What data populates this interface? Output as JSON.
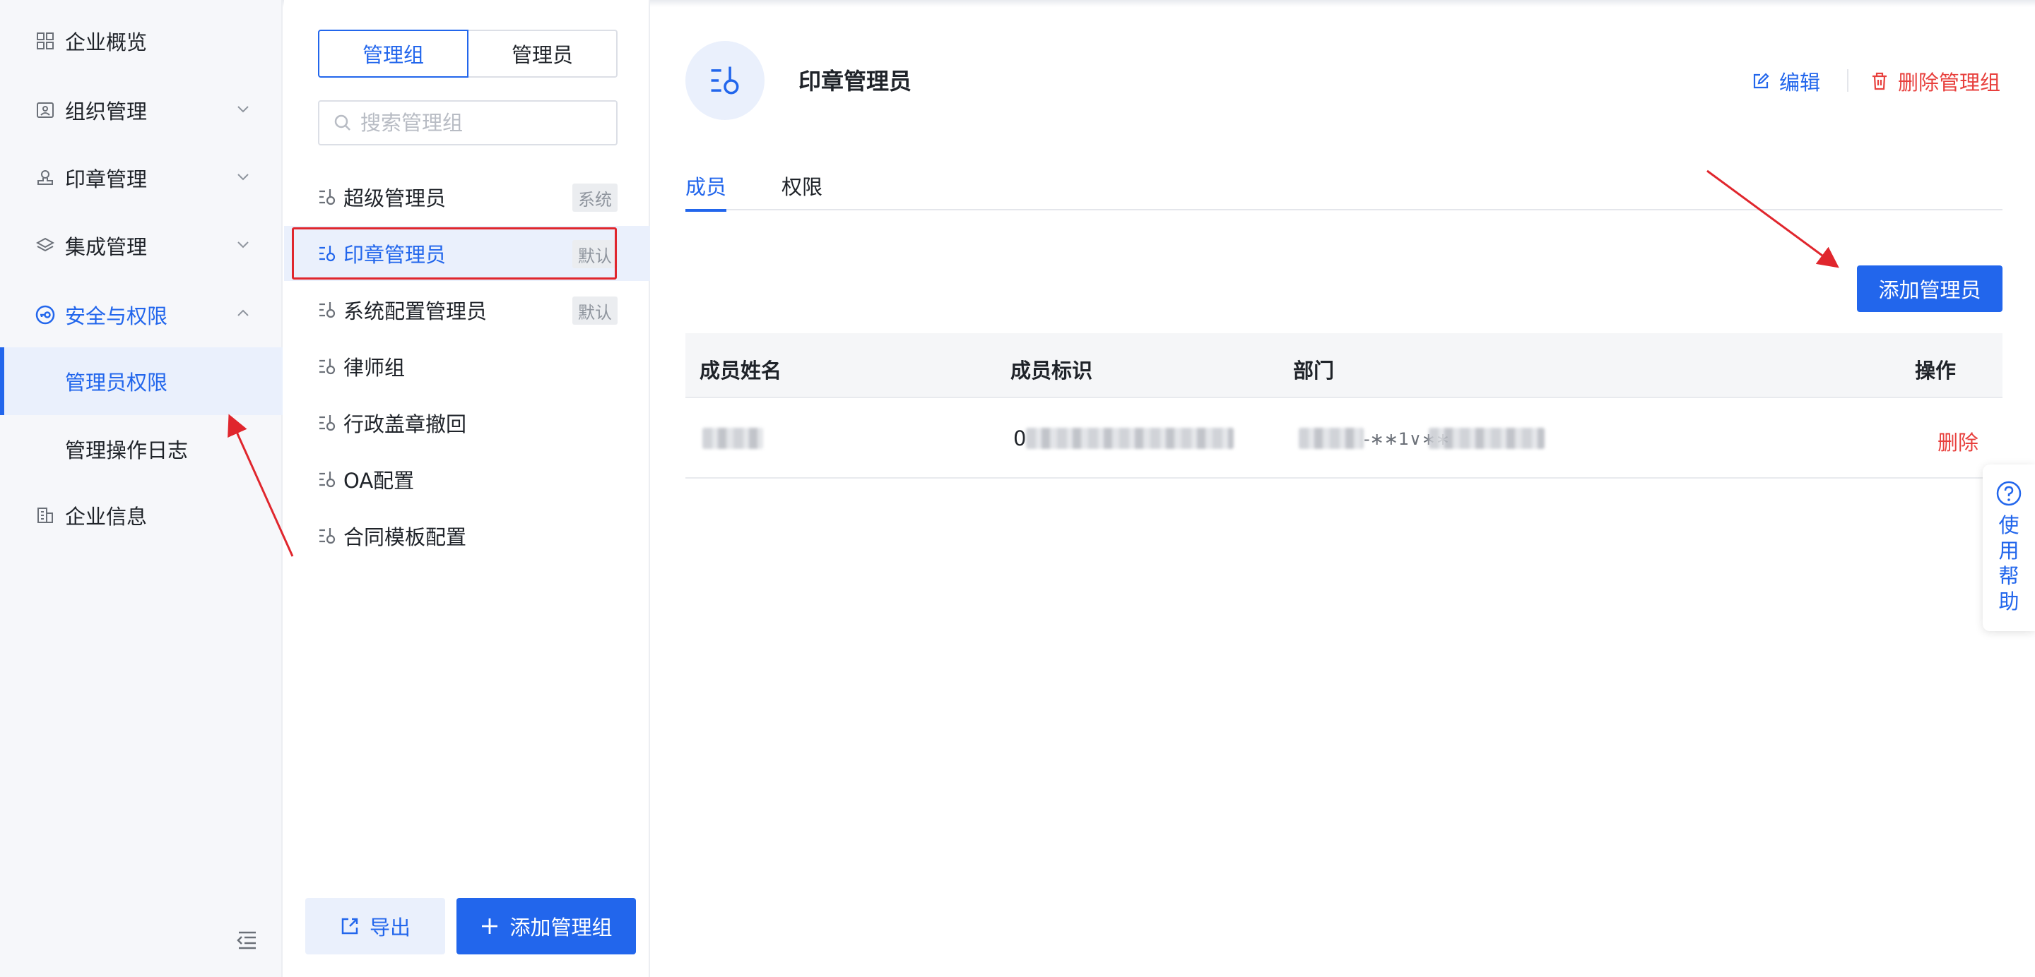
{
  "sidebar": {
    "items": [
      {
        "label": "企业概览",
        "icon": "dashboard-icon"
      },
      {
        "label": "组织管理",
        "icon": "org-icon"
      },
      {
        "label": "印章管理",
        "icon": "seal-icon"
      },
      {
        "label": "集成管理",
        "icon": "layers-icon"
      },
      {
        "label": "安全与权限",
        "icon": "key-icon"
      }
    ],
    "sub_items": [
      {
        "label": "管理员权限"
      },
      {
        "label": "管理操作日志"
      }
    ],
    "last_item": {
      "label": "企业信息",
      "icon": "building-icon"
    }
  },
  "middle": {
    "segment": {
      "groups": "管理组",
      "admins": "管理员"
    },
    "search_placeholder": "搜索管理组",
    "groups": [
      {
        "name": "超级管理员",
        "tag": "系统"
      },
      {
        "name": "印章管理员",
        "tag": "默认"
      },
      {
        "name": "系统配置管理员",
        "tag": "默认"
      },
      {
        "name": "律师组",
        "tag": ""
      },
      {
        "name": "行政盖章撤回",
        "tag": ""
      },
      {
        "name": "OA配置",
        "tag": ""
      },
      {
        "name": "合同模板配置",
        "tag": ""
      }
    ],
    "export_label": "导出",
    "add_group_label": "添加管理组"
  },
  "main": {
    "title": "印章管理员",
    "edit_label": "编辑",
    "delete_group_label": "删除管理组",
    "tabs": [
      {
        "label": "成员"
      },
      {
        "label": "权限"
      }
    ],
    "add_admin_label": "添加管理员",
    "table": {
      "columns": [
        "成员姓名",
        "成员标识",
        "部门",
        "操作"
      ],
      "rows": [
        {
          "id_prefix": "0",
          "dept_mid": "-∗∗1∨∗∗",
          "action": "删除"
        }
      ]
    }
  },
  "help": {
    "label": "使用帮助"
  },
  "colors": {
    "accent": "#2266ec",
    "danger": "#e8403d",
    "annotation": "#e0262d"
  }
}
